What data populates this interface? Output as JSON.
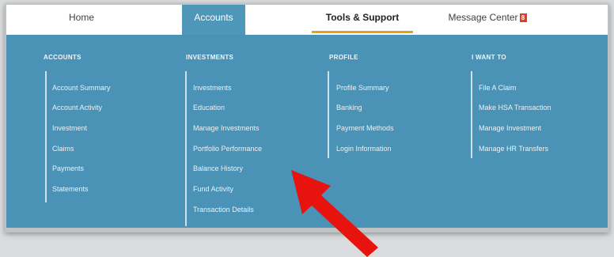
{
  "nav": {
    "home": "Home",
    "accounts": "Accounts",
    "tools": "Tools & Support",
    "messages": "Message Center",
    "message_badge": "8"
  },
  "menu": {
    "accounts": {
      "title": "ACCOUNTS",
      "items": [
        "Account Summary",
        "Account Activity",
        "Investment",
        "Claims",
        "Payments",
        "Statements"
      ]
    },
    "investments": {
      "title": "INVESTMENTS",
      "items": [
        "Investments",
        "Education",
        "Manage Investments",
        "Portfolio Performance",
        "Balance History",
        "Fund Activity",
        "Transaction Details"
      ]
    },
    "profile": {
      "title": "PROFILE",
      "items": [
        "Profile Summary",
        "Banking",
        "Payment Methods",
        "Login Information"
      ]
    },
    "iwant": {
      "title": "I WANT TO",
      "items": [
        "File A Claim",
        "Make HSA Transaction",
        "Manage Investment",
        "Manage HR Transfers"
      ]
    }
  },
  "colors": {
    "panel": "#4a93b7",
    "active_tab": "#4e97b8",
    "tools_underline": "#e0a21a",
    "arrow": "#e8130f"
  }
}
